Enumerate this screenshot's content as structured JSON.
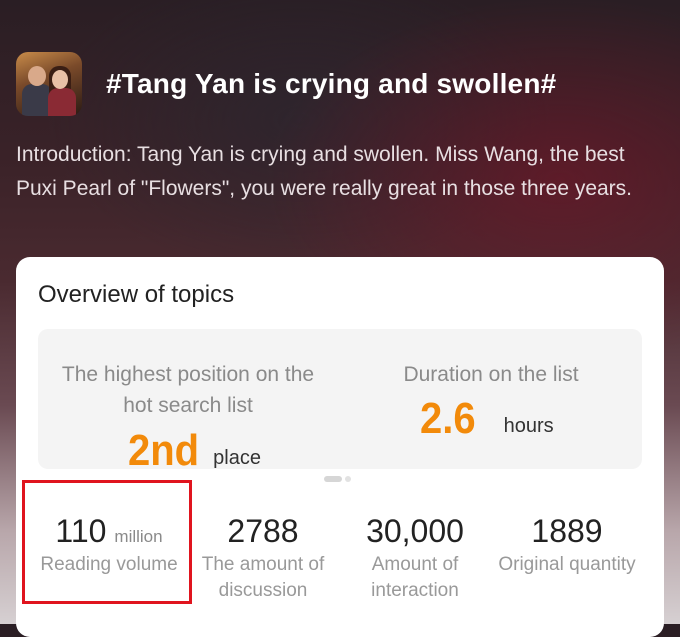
{
  "topic": {
    "title": "#Tang Yan is crying and swollen#",
    "intro": "Introduction: Tang Yan is crying and swollen. Miss Wang, the best Puxi Pearl of \"Flowers\", you were really great in those three years."
  },
  "overview": {
    "title": "Overview of topics",
    "highest_position": {
      "label": "The highest position on the hot search list",
      "value": "2nd",
      "unit": "place"
    },
    "duration": {
      "label": "Duration on the list",
      "value": "2.6",
      "unit": "hours"
    },
    "stats": [
      {
        "value": "110",
        "unit": "million",
        "label": "Reading volume"
      },
      {
        "value": "2788",
        "unit": "",
        "label": "The amount of discussion"
      },
      {
        "value": "30,000",
        "unit": "",
        "label": "Amount of interaction"
      },
      {
        "value": "1889",
        "unit": "",
        "label": "Original quantity"
      }
    ]
  },
  "colors": {
    "accent_orange": "#f28a0a",
    "highlight_red": "#e0141e"
  }
}
